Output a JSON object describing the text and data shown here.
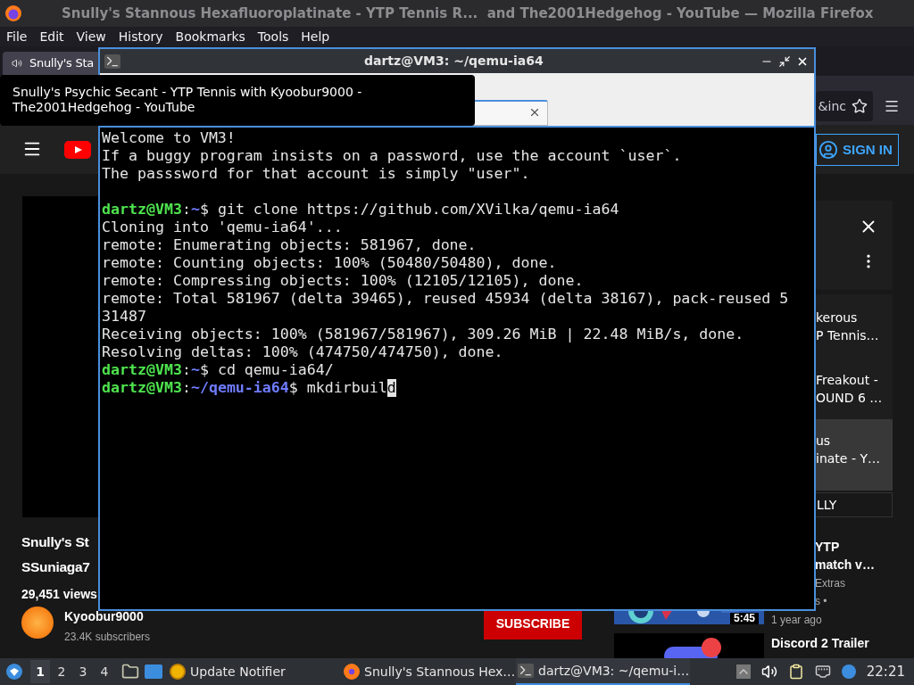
{
  "browser": {
    "title": "Snully's Stannous Hexafluoroplatinate - YTP Tennis R...  and The2001Hedgehog - YouTube — Mozilla Firefox",
    "menu": [
      "File",
      "Edit",
      "View",
      "History",
      "Bookmarks",
      "Tools",
      "Help"
    ],
    "tab": {
      "title": "Snully's Sta"
    },
    "tooltip": "Snully's Psychic Secant - YTP Tennis with Kyoobur9000 - The2001Hedgehog - YouTube",
    "address_fragment": "&inc",
    "youtube": {
      "sign_in": "SIGN IN",
      "video": {
        "title_lines": [
          "Snully's St",
          "SSuniaga7"
        ],
        "views": "29,451 views",
        "channel": "Kyoobur9000",
        "subscribers": "23.4K subscribers",
        "subscribe": "SUBSCRIBE"
      },
      "playlist": [
        {
          "kind": "item",
          "lines": [
            "kerous",
            "P Tennis…"
          ]
        },
        {
          "kind": "item",
          "lines": [
            "Freakout -",
            "OUND 6 …"
          ]
        },
        {
          "kind": "current",
          "lines": [
            "us",
            "inate - Y…"
          ]
        },
        {
          "kind": "chip",
          "lines": [
            "LLY"
          ]
        }
      ],
      "recommended": [
        {
          "lines": [
            "YTP",
            "match v…"
          ],
          "meta": [
            "Extras",
            "s •"
          ],
          "duration": "5:45",
          "age": "1 year ago"
        },
        {
          "lines": [
            "Discord 2 Trailer"
          ]
        }
      ]
    }
  },
  "terminal": {
    "title": "dartz@VM3: ~/qemu-ia64",
    "lines": [
      {
        "kind": "text",
        "text": "Welcome to VM3!"
      },
      {
        "kind": "text",
        "text": "If a buggy program insists on a password, use the account `user`."
      },
      {
        "kind": "text",
        "text": "The passsword for that account is simply \"user\"."
      },
      {
        "kind": "blank"
      },
      {
        "kind": "prompt",
        "user": "dartz@VM3",
        "colon": ":",
        "path": "~",
        "dollar": "$",
        "command": "git clone https://github.com/XVilka/qemu-ia64",
        "cursor": false
      },
      {
        "kind": "text",
        "text": "Cloning into 'qemu-ia64'..."
      },
      {
        "kind": "text",
        "text": "remote: Enumerating objects: 581967, done."
      },
      {
        "kind": "text",
        "text": "remote: Counting objects: 100% (50480/50480), done."
      },
      {
        "kind": "text",
        "text": "remote: Compressing objects: 100% (12105/12105), done."
      },
      {
        "kind": "text",
        "text": "remote: Total 581967 (delta 39465), reused 45934 (delta 38167), pack-reused 5"
      },
      {
        "kind": "text",
        "text": "31487"
      },
      {
        "kind": "text",
        "text": "Receiving objects: 100% (581967/581967), 309.26 MiB | 22.48 MiB/s, done."
      },
      {
        "kind": "text",
        "text": "Resolving deltas: 100% (474750/474750), done."
      },
      {
        "kind": "prompt",
        "user": "dartz@VM3",
        "colon": ":",
        "path": "~",
        "dollar": "$",
        "command": "cd qemu-ia64/",
        "cursor": false
      },
      {
        "kind": "prompt",
        "user": "dartz@VM3",
        "colon": ":",
        "path": "~/qemu-ia64",
        "dollar": "$",
        "command": "mkdirbuild",
        "cursor": true
      }
    ]
  },
  "taskbar": {
    "workspaces": [
      {
        "label": "1",
        "selected": true
      },
      {
        "label": "2",
        "selected": false
      },
      {
        "label": "3",
        "selected": false
      },
      {
        "label": "4",
        "selected": false
      }
    ],
    "tasks": [
      {
        "kind": "updater",
        "label": "Update Notifier",
        "selected": false
      },
      {
        "kind": "firefox",
        "label": "Snully's Stannous Hex…",
        "selected": false
      },
      {
        "kind": "terminal",
        "label": "dartz@VM3: ~/qemu-i…",
        "selected": true
      }
    ],
    "clock": "22:21"
  }
}
